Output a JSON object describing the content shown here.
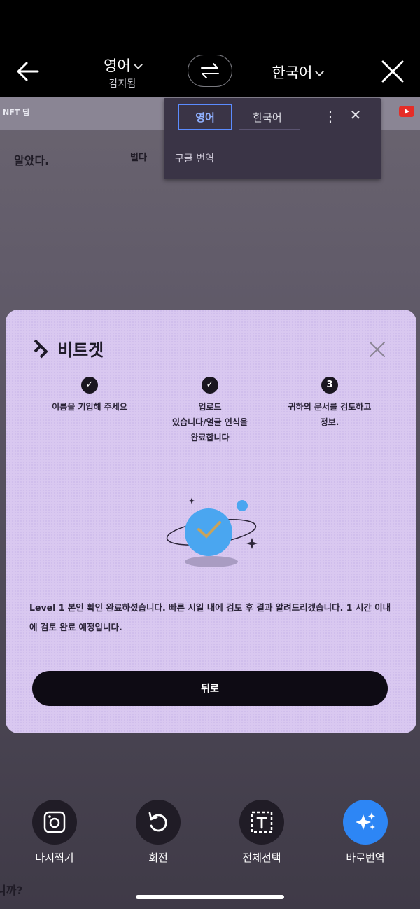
{
  "topbar": {
    "source_lang": "영어",
    "source_status": "감지됨",
    "target_lang": "한국어"
  },
  "background": {
    "nft_tip": "NFT 딥",
    "text_left": "알았다.",
    "text_mid": "벌다",
    "text_bottom": "니까?"
  },
  "popup": {
    "tab_active": "영어",
    "tab_other": "한국어",
    "more": "⋮",
    "close": "✕",
    "service": "구글 번역"
  },
  "modal": {
    "logo_text": "비트겟",
    "steps": [
      {
        "marker": "✓",
        "line1": "이름을 기입해 주세요",
        "line2": ""
      },
      {
        "marker": "✓",
        "line1": "업로드",
        "line2": "있습니다/얼굴 인식을",
        "line3": "완료합니다"
      },
      {
        "marker": "3",
        "line1": "귀하의 문서를 검토하고",
        "line2": "정보."
      }
    ],
    "message": "Level 1 본인 확인 완료하셨습니다. 빠른 시일 내에 검토 후 결과 알려드리겠습니다. 1 시간 이내에 검토 완료 예정입니다.",
    "back_button": "뒤로"
  },
  "toolbar": {
    "retake": "다시찍기",
    "rotate": "회전",
    "select_all": "전체선택",
    "instant_translate": "바로번역"
  },
  "colors": {
    "accent_blue": "#2d86f5",
    "modal_bg": "#d9c8f0"
  }
}
